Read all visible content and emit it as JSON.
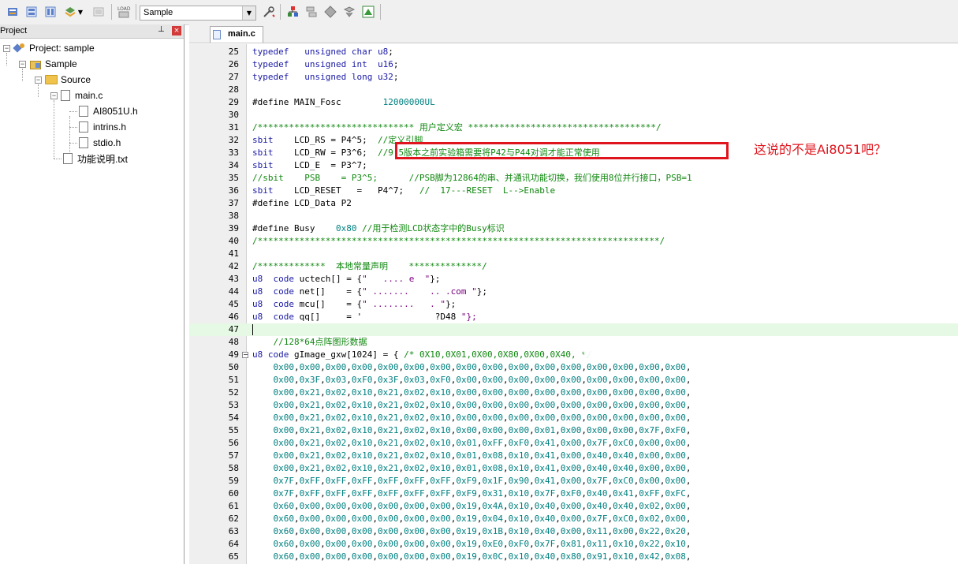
{
  "toolbar": {
    "target_value": "Sample",
    "buttons_left": [
      "translate-icon",
      "build-icon",
      "rebuild-icon",
      "batch-build-icon",
      "stop-build-icon",
      "load-icon"
    ],
    "buttons_right": [
      "options-icon",
      "manage-components-icon",
      "file-extensions-icon",
      "select-packs-icon",
      "pack-installer-icon",
      "run-environment-icon"
    ]
  },
  "project_panel": {
    "title": "Project",
    "pin": "⊥",
    "close": "×",
    "tree": [
      {
        "label": "Project: sample",
        "level": 0,
        "type": "project",
        "toggle": "−"
      },
      {
        "label": "Sample",
        "level": 1,
        "type": "target",
        "toggle": "−"
      },
      {
        "label": "Source",
        "level": 2,
        "type": "group",
        "toggle": "−"
      },
      {
        "label": "main.c",
        "level": 3,
        "type": "file",
        "toggle": "−"
      },
      {
        "label": "AI8051U.h",
        "level": 4,
        "type": "file"
      },
      {
        "label": "intrins.h",
        "level": 4,
        "type": "file"
      },
      {
        "label": "stdio.h",
        "level": 4,
        "type": "file"
      },
      {
        "label": "功能说明.txt",
        "level": 3,
        "type": "file"
      }
    ]
  },
  "editor": {
    "tab_label": "main.c",
    "lines": [
      {
        "n": "25",
        "t": "typedef   unsigned char u8;"
      },
      {
        "n": "26",
        "t": "typedef   unsigned int  u16;"
      },
      {
        "n": "27",
        "t": "typedef   unsigned long u32;"
      },
      {
        "n": "28",
        "t": ""
      },
      {
        "n": "29",
        "t": "#define MAIN_Fosc        12000000UL"
      },
      {
        "n": "30",
        "t": ""
      },
      {
        "n": "31",
        "t": "/****************************** 用户定义宏 ************************************/"
      },
      {
        "n": "32",
        "t": "sbit    LCD_RS = P4^5;  //定义引脚"
      },
      {
        "n": "33",
        "t": "sbit    LCD_RW = P3^6;  //9.5版本之前实验箱需要将P42与P44对调才能正常使用"
      },
      {
        "n": "34",
        "t": "sbit    LCD_E  = P3^7;"
      },
      {
        "n": "35",
        "t": "//sbit    PSB    = P3^5;      //PSB脚为12864的串、并通讯功能切换，我们使用8位并行接口，PSB=1"
      },
      {
        "n": "36",
        "t": "sbit    LCD_RESET   =   P4^7;   //  17---RESET  L-->Enable"
      },
      {
        "n": "37",
        "t": "#define LCD_Data P2"
      },
      {
        "n": "38",
        "t": ""
      },
      {
        "n": "39",
        "t": "#define Busy    0x80 //用于检测LCD状态字中的Busy标识"
      },
      {
        "n": "40",
        "t": "/*****************************************************************************/"
      },
      {
        "n": "41",
        "t": ""
      },
      {
        "n": "42",
        "t": "/*************  本地常量声明    **************/"
      },
      {
        "n": "43",
        "t": "u8  code uctech[] = {\"   .... e  \"};"
      },
      {
        "n": "44",
        "t": "u8  code net[]    = {\" .......    .. .com \"};"
      },
      {
        "n": "45",
        "t": "u8  code mcu[]    = {\" ........   . \"};"
      },
      {
        "n": "46",
        "t": "u8  code qq[]     = '              ?D48 \"};"
      },
      {
        "n": "47",
        "t": ""
      },
      {
        "n": "48",
        "t": "    //128*64点阵图形数据"
      },
      {
        "n": "49",
        "t": "u8 code gImage_gxw[1024] = { /* 0X10,0X01,0X00,0X80,0X00,0X40, */"
      },
      {
        "n": "50",
        "t": "    0x00,0x00,0x00,0x00,0x00,0x00,0x00,0x00,0x00,0x00,0x00,0x00,0x00,0x00,0x00,0x00,"
      },
      {
        "n": "51",
        "t": "    0x00,0x3F,0x03,0xF0,0x3F,0x03,0xF0,0x00,0x00,0x00,0x00,0x00,0x00,0x00,0x00,0x00,"
      },
      {
        "n": "52",
        "t": "    0x00,0x21,0x02,0x10,0x21,0x02,0x10,0x00,0x00,0x00,0x00,0x00,0x00,0x00,0x00,0x00,"
      },
      {
        "n": "53",
        "t": "    0x00,0x21,0x02,0x10,0x21,0x02,0x10,0x00,0x00,0x00,0x00,0x00,0x00,0x00,0x00,0x00,"
      },
      {
        "n": "54",
        "t": "    0x00,0x21,0x02,0x10,0x21,0x02,0x10,0x00,0x00,0x00,0x00,0x00,0x00,0x00,0x00,0x00,"
      },
      {
        "n": "55",
        "t": "    0x00,0x21,0x02,0x10,0x21,0x02,0x10,0x00,0x00,0x00,0x01,0x00,0x00,0x00,0x7F,0xF0,"
      },
      {
        "n": "56",
        "t": "    0x00,0x21,0x02,0x10,0x21,0x02,0x10,0x01,0xFF,0xF0,0x41,0x00,0x7F,0xC0,0x00,0x00,"
      },
      {
        "n": "57",
        "t": "    0x00,0x21,0x02,0x10,0x21,0x02,0x10,0x01,0x08,0x10,0x41,0x00,0x40,0x40,0x00,0x00,"
      },
      {
        "n": "58",
        "t": "    0x00,0x21,0x02,0x10,0x21,0x02,0x10,0x01,0x08,0x10,0x41,0x00,0x40,0x40,0x00,0x00,"
      },
      {
        "n": "59",
        "t": "    0x7F,0xFF,0xFF,0xFF,0xFF,0xFF,0xFF,0xF9,0x1F,0x90,0x41,0x00,0x7F,0xC0,0x00,0x00,"
      },
      {
        "n": "60",
        "t": "    0x7F,0xFF,0xFF,0xFF,0xFF,0xFF,0xFF,0xF9,0x31,0x10,0x7F,0xF0,0x40,0x41,0xFF,0xFC,"
      },
      {
        "n": "61",
        "t": "    0x60,0x00,0x00,0x00,0x00,0x00,0x00,0x19,0x4A,0x10,0x40,0x00,0x40,0x40,0x02,0x00,"
      },
      {
        "n": "62",
        "t": "    0x60,0x00,0x00,0x00,0x00,0x00,0x00,0x19,0x04,0x10,0x40,0x00,0x7F,0xC0,0x02,0x00,"
      },
      {
        "n": "63",
        "t": "    0x60,0x00,0x00,0x00,0x00,0x00,0x00,0x19,0x1B,0x10,0x40,0x00,0x11,0x00,0x22,0x20,"
      },
      {
        "n": "64",
        "t": "    0x60,0x00,0x00,0x00,0x00,0x00,0x00,0x19,0xE0,0xF0,0x7F,0x81,0x11,0x10,0x22,0x10,"
      },
      {
        "n": "65",
        "t": "    0x60,0x00,0x00,0x00,0x00,0x00,0x00,0x19,0x0C,0x10,0x40,0x80,0x91,0x10,0x42,0x08,"
      }
    ],
    "current_line": "47",
    "fold_line": "49",
    "annotation": "这说的不是Ai8051吧？",
    "annotation_color": "#e0141c"
  }
}
